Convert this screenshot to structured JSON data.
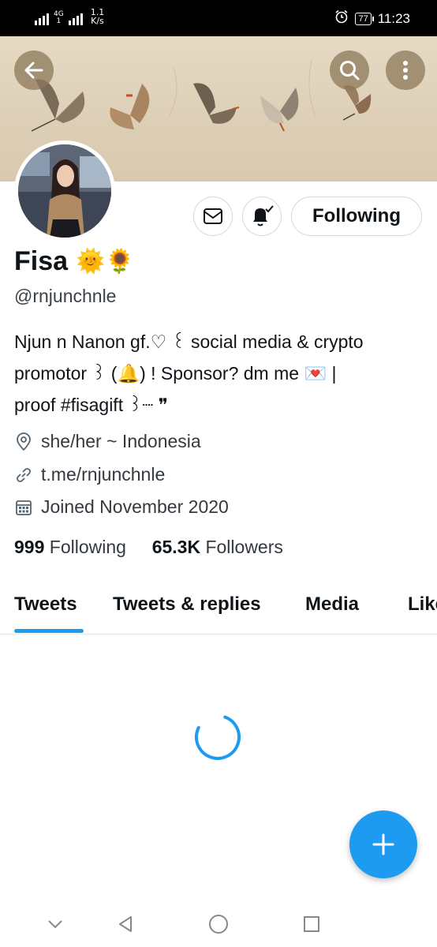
{
  "status_bar": {
    "network_top": "4G",
    "network_bottom": "1",
    "speed_value": "1.1",
    "speed_unit": "K/s",
    "battery": "77",
    "time": "11:23"
  },
  "header": {
    "back_icon": "arrow-left-icon",
    "search_icon": "search-icon",
    "more_icon": "more-vertical-icon"
  },
  "profile": {
    "display_name": "Fisa",
    "name_emojis": "🌞🌻",
    "handle": "@rnjunchnle",
    "bio_line1": "Njun n Nanon gf.♡  ꒰ social media & crypto",
    "bio_line2": "promotor ꒱ (🔔) ! Sponsor? dm me 💌 |",
    "bio_line3": "proof #fisagift ꒱┈ ❞",
    "pronouns_location": "she/her ~ Indonesia",
    "link": "t.me/rnjunchnle",
    "joined": "Joined November 2020",
    "following_count": "999",
    "following_label": "Following",
    "followers_count": "65.3K",
    "followers_label": "Followers"
  },
  "actions": {
    "message_icon": "mail-icon",
    "notify_icon": "bell-check-icon",
    "following_button": "Following"
  },
  "tabs": [
    {
      "label": "Tweets",
      "active": true
    },
    {
      "label": "Tweets & replies",
      "active": false
    },
    {
      "label": "Media",
      "active": false
    },
    {
      "label": "Likes",
      "active": false
    }
  ],
  "colors": {
    "accent": "#1d9bf0",
    "text": "#0f1419",
    "border": "#cfd9de"
  },
  "fab_icon": "plus-icon",
  "nav": {
    "collapse_icon": "chevron-down-icon",
    "back_icon": "triangle-back-icon",
    "home_icon": "circle-home-icon",
    "recents_icon": "square-recents-icon"
  }
}
